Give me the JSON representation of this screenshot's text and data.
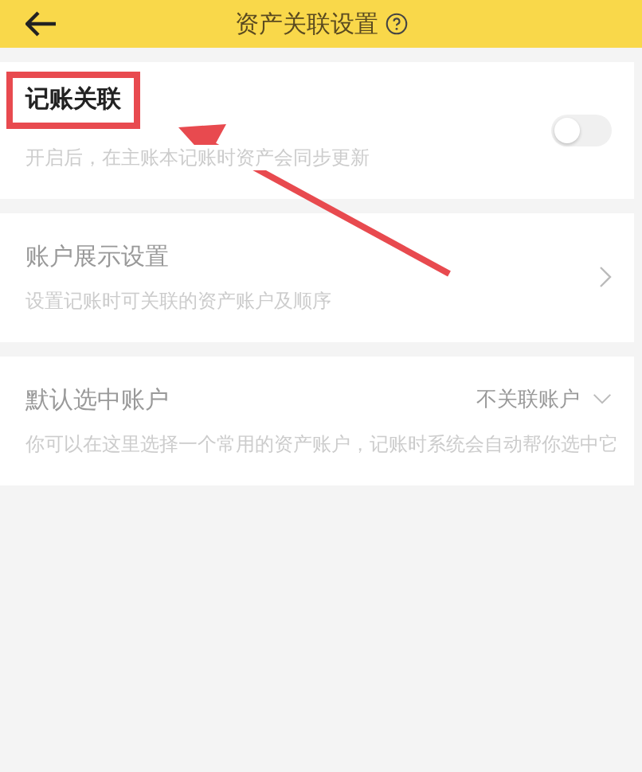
{
  "header": {
    "title": "资产关联设置"
  },
  "sections": [
    {
      "kind": "toggle",
      "title": "记账关联",
      "description": "开启后，在主账本记账时资产会同步更新",
      "on": false,
      "highlighted": true
    },
    {
      "kind": "link",
      "title": "账户展示设置",
      "description": "设置记账时可关联的资产账户及顺序",
      "highlighted": false
    },
    {
      "kind": "select",
      "title": "默认选中账户",
      "value": "不关联账户",
      "description": "你可以在这里选择一个常用的资产账户，记账时系统会自动帮你选中它",
      "highlighted": false
    }
  ]
}
